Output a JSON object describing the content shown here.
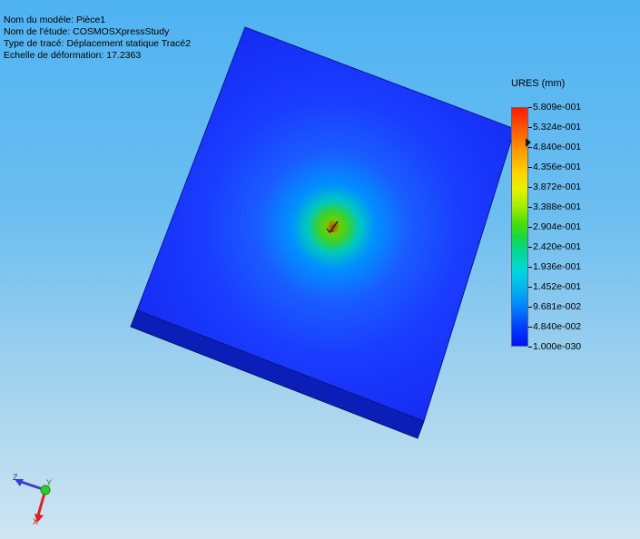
{
  "info": {
    "model_name": "Nom du modèle: Pièce1",
    "study_name": "Nom de l'étude: COSMOSXpressStudy",
    "plot_type": "Type de tracé: Déplacement statique Tracé2",
    "deformation_scale": "Echelle de déformation: 17.2363"
  },
  "legend": {
    "title": "URES (mm)",
    "labels": [
      "5.809e-001",
      "5.324e-001",
      "4.840e-001",
      "4.356e-001",
      "3.872e-001",
      "3.388e-001",
      "2.904e-001",
      "2.420e-001",
      "1.936e-001",
      "1.452e-001",
      "9.681e-002",
      "4.840e-002",
      "1.000e-030"
    ],
    "color_max": "#ff1a00",
    "color_min": "#0010ff"
  },
  "triad": {
    "z_label": "Z",
    "y_label": "Y",
    "x_label": "X",
    "z_color": "#3b3bd8",
    "y_color": "#2ecc2e",
    "x_color": "#e02020"
  },
  "model": {
    "top_face_color": "#1a34ff",
    "side_face_color": "#0b1fb8",
    "hotspot_color": "#6ad000"
  }
}
